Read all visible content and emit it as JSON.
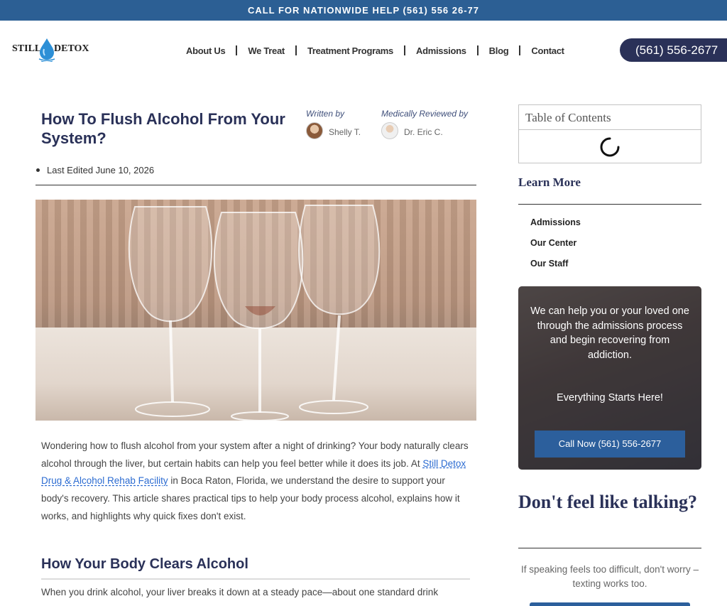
{
  "topbar": {
    "text": "CALL FOR NATIONWIDE HELP (561) 556 26-77"
  },
  "logo": {
    "still": "STILL",
    "detox": "DETOX"
  },
  "nav": {
    "items": [
      "About Us",
      "We Treat",
      "Treatment Programs",
      "Admissions",
      "Blog",
      "Contact"
    ]
  },
  "header_phone": "(561) 556-2677",
  "article": {
    "title": "How To Flush Alcohol From Your System?",
    "written_label": "Written by",
    "written_name": "Shelly T.",
    "reviewed_label": "Medically Reviewed by",
    "reviewed_name": "Dr. Eric C.",
    "last_edited": "Last Edited June 10, 2026",
    "intro_part1": "Wondering how to flush alcohol from your system after a night of drinking? Your body naturally clears alcohol through the liver, but certain habits can help you feel better while it does its job. At ",
    "intro_link": "Still Detox Drug & Alcohol Rehab Facility",
    "intro_part2": " in Boca Raton, Florida, we understand the desire to support your body's recovery. This article shares practical tips to help your body process alcohol, explains how it works, and highlights why quick fixes don't exist.",
    "section_heading": "How Your Body Clears Alcohol",
    "section_text": "When you drink alcohol, your liver breaks it down at a steady pace—about one standard drink"
  },
  "sidebar": {
    "toc_title": "Table of Contents",
    "learn_more_title": "Learn More",
    "learn_links": [
      "Admissions",
      "Our Center",
      "Our Staff"
    ],
    "cta_text": "We can help you or your loved one through the admissions process and begin recovering from addiction.",
    "cta_sub": "Everything Starts Here!",
    "cta_button": "Call Now (561) 556-2677",
    "dont_title": "Don't feel like talking?",
    "dont_text": "If speaking feels too difficult, don't worry – texting works too."
  },
  "colors": {
    "brand_navy": "#2a3158",
    "topbar_blue": "#2c5f94",
    "button_blue": "#2c5f9c",
    "link_blue": "#2b6bd1"
  }
}
